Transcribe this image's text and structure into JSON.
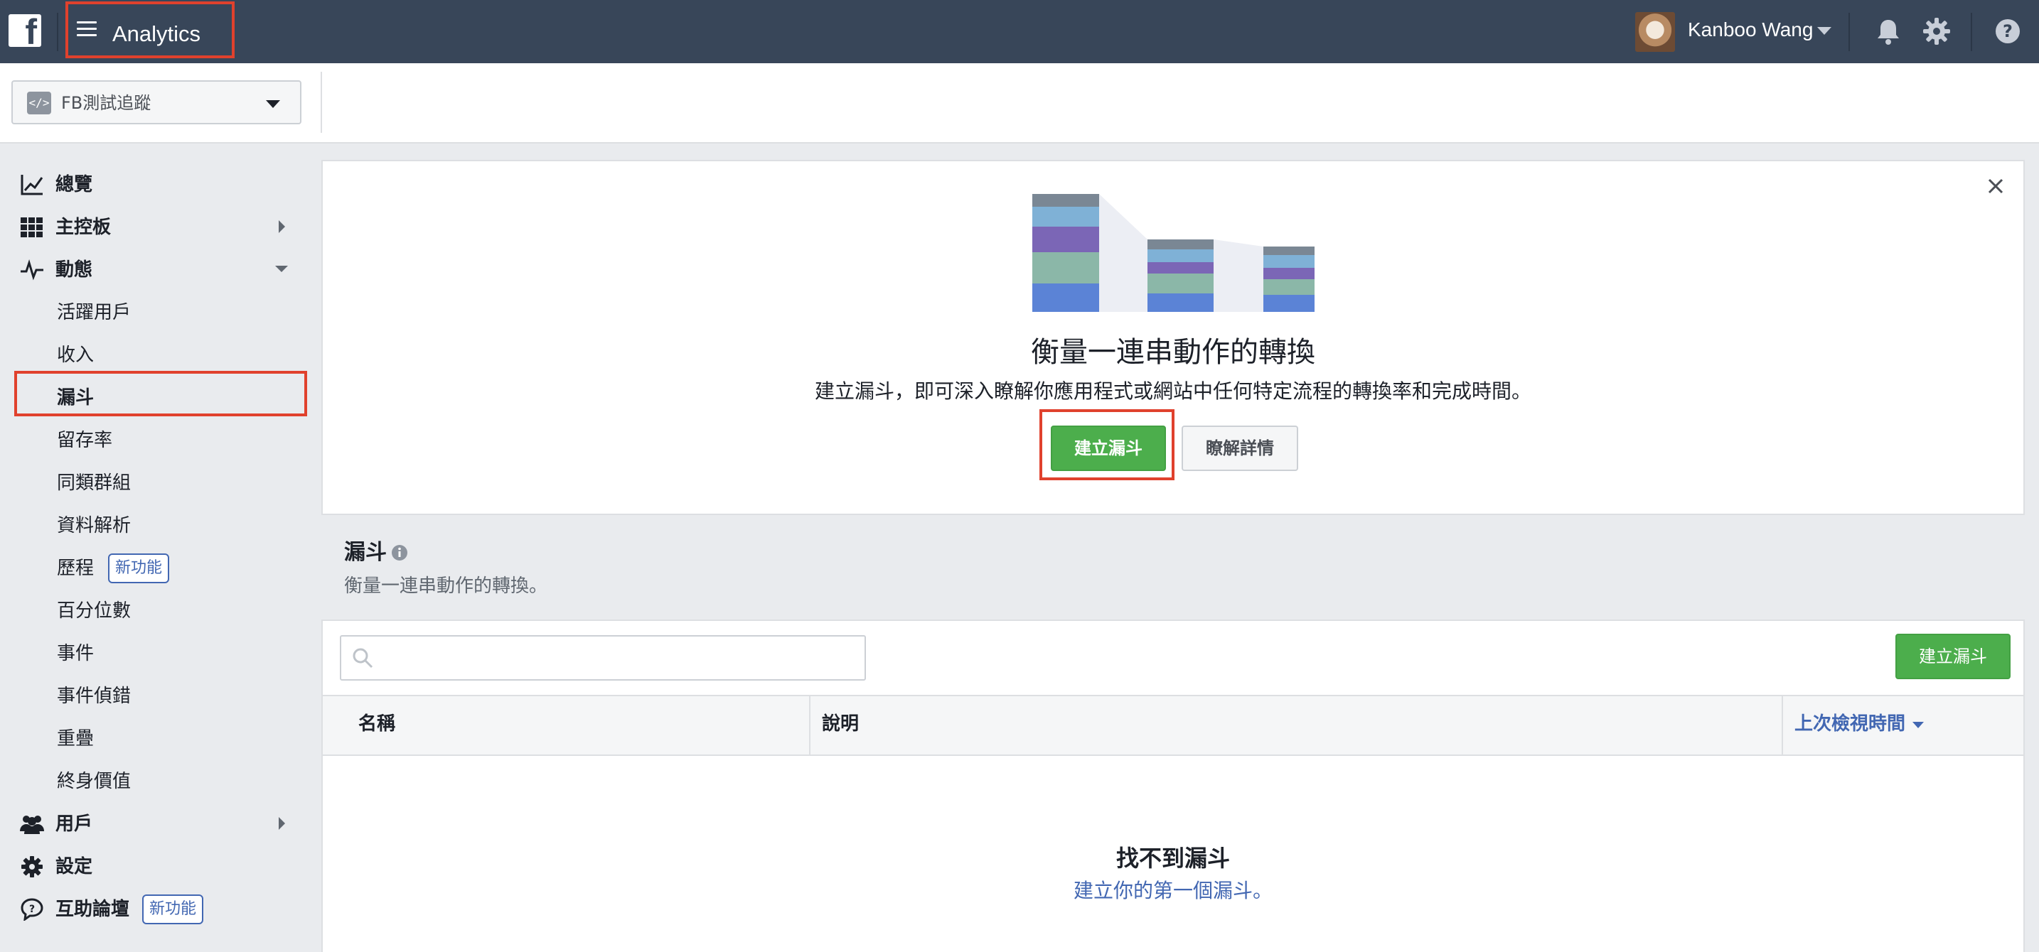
{
  "topbar": {
    "logo_letter": "f",
    "app_title": "Analytics",
    "user_name": "Kanboo Wang",
    "icons": [
      "menu-icon",
      "bell-icon",
      "gear-icon",
      "help-icon"
    ]
  },
  "app_picker": {
    "icon_glyph": "</>",
    "selected_app": "FB測試追蹤"
  },
  "sidebar": {
    "items": [
      {
        "label": "總覽",
        "icon": "line-chart-icon"
      },
      {
        "label": "主控板",
        "icon": "grid-icon"
      },
      {
        "label": "動態",
        "icon": "activity-icon"
      },
      {
        "label": "活躍用戶"
      },
      {
        "label": "收入"
      },
      {
        "label": "漏斗"
      },
      {
        "label": "留存率"
      },
      {
        "label": "同類群組"
      },
      {
        "label": "資料解析"
      },
      {
        "label": "歷程",
        "badge": "新功能"
      },
      {
        "label": "百分位數"
      },
      {
        "label": "事件"
      },
      {
        "label": "事件偵錯"
      },
      {
        "label": "重疊"
      },
      {
        "label": "終身價值"
      },
      {
        "label": "用戶",
        "icon": "users-icon"
      },
      {
        "label": "設定",
        "icon": "gear-icon"
      },
      {
        "label": "互助論壇",
        "icon": "question-bubble-icon",
        "badge": "新功能"
      }
    ],
    "selected": "漏斗"
  },
  "promo": {
    "title": "衡量一連串動作的轉換",
    "description": "建立漏斗，即可深入瞭解你應用程式或網站中任何特定流程的轉換率和完成時間。",
    "primary_button": "建立漏斗",
    "secondary_button": "瞭解詳情",
    "close_icon": "close-icon",
    "illustration": "funnel-chart-illustration"
  },
  "funnels": {
    "title": "漏斗",
    "subtitle": "衡量一連串動作的轉換。",
    "search_placeholder": "",
    "create_button": "建立漏斗",
    "columns": [
      "名稱",
      "說明",
      "上次檢視時間"
    ],
    "empty_title": "找不到漏斗",
    "empty_link": "建立你的第一個漏斗。"
  },
  "colors": {
    "topbar": "#384659",
    "accent": "#4267b2",
    "primary_button": "#4cae4c",
    "highlight": "#e0412d"
  }
}
